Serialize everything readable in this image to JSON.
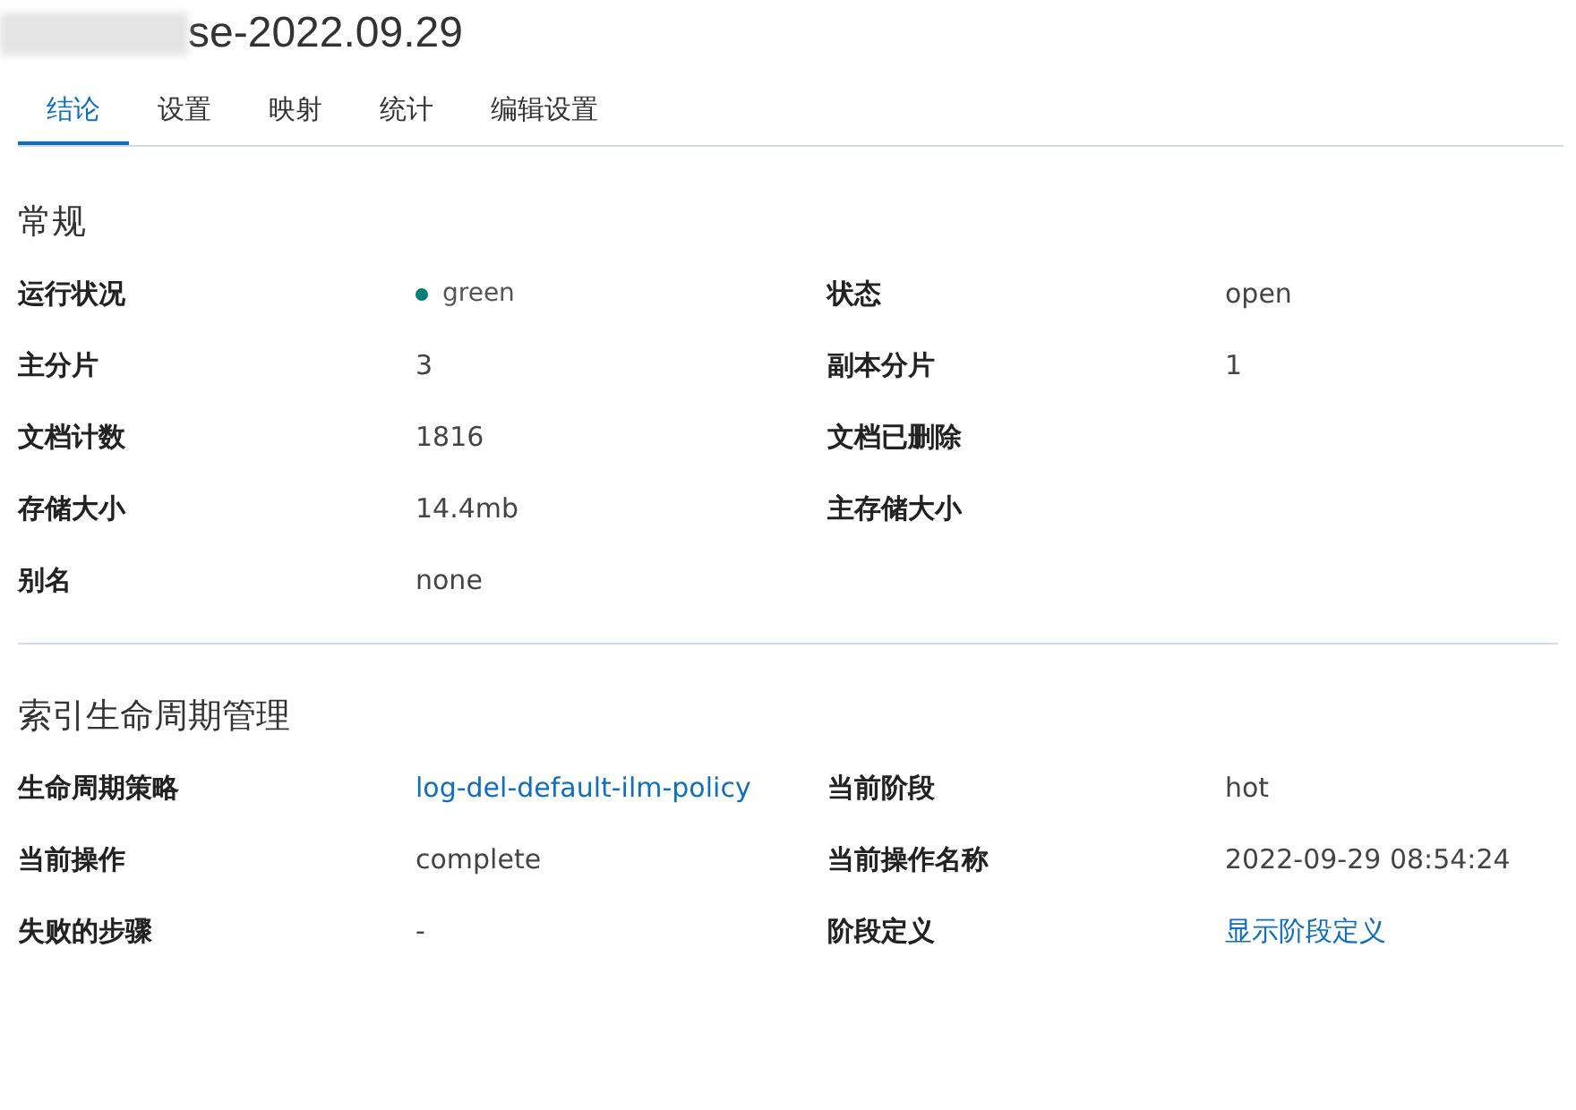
{
  "title": "se-2022.09.29",
  "tabs": [
    {
      "label": "结论",
      "selected": true
    },
    {
      "label": "设置",
      "selected": false
    },
    {
      "label": "映射",
      "selected": false
    },
    {
      "label": "统计",
      "selected": false
    },
    {
      "label": "编辑设置",
      "selected": false
    }
  ],
  "sections": [
    {
      "heading": "常规",
      "fields": [
        {
          "label": "运行状况",
          "value": "green",
          "kind": "status",
          "color": "#017d73"
        },
        {
          "label": "状态",
          "value": "open",
          "kind": "text"
        },
        {
          "label": "主分片",
          "value": "3",
          "kind": "text"
        },
        {
          "label": "副本分片",
          "value": "1",
          "kind": "text"
        },
        {
          "label": "文档计数",
          "value": "1816",
          "kind": "text"
        },
        {
          "label": "文档已删除"
        },
        {
          "label": "存储大小",
          "value": "14.4mb",
          "kind": "text"
        },
        {
          "label": "主存储大小"
        },
        {
          "label": "别名",
          "value": "none",
          "kind": "text"
        }
      ]
    },
    {
      "heading": "索引生命周期管理",
      "fields": [
        {
          "label": "生命周期策略",
          "value": "log-del-default-ilm-policy",
          "kind": "link"
        },
        {
          "label": "当前阶段",
          "value": "hot",
          "kind": "text"
        },
        {
          "label": "当前操作",
          "value": "complete",
          "kind": "text"
        },
        {
          "label": "当前操作名称",
          "value": "2022-09-29 08:54:24",
          "kind": "text"
        },
        {
          "label": "失败的步骤",
          "value": "-",
          "kind": "text"
        },
        {
          "label": "阶段定义",
          "value": "显示阶段定义",
          "kind": "link"
        }
      ]
    }
  ]
}
